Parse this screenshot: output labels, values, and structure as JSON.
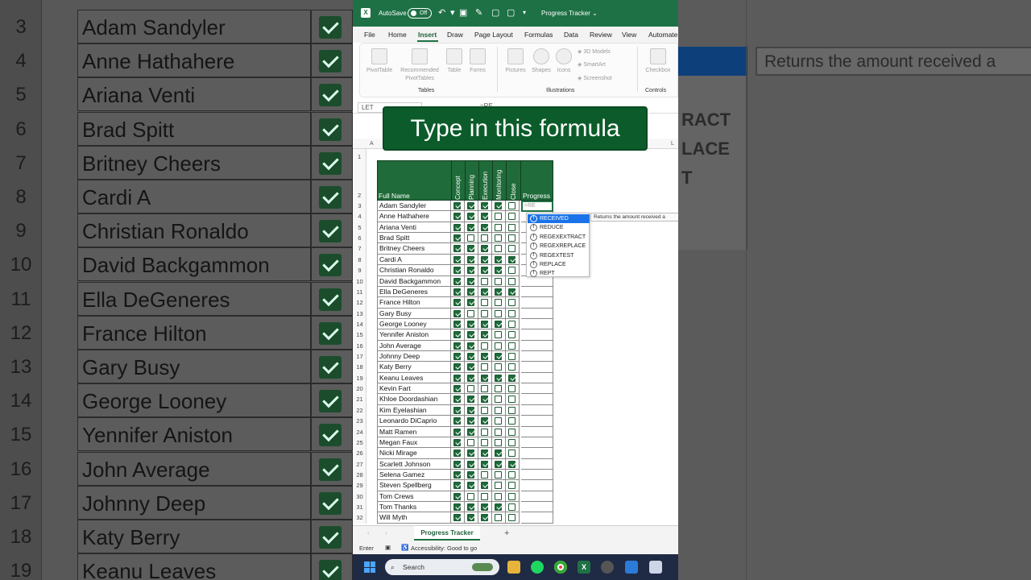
{
  "background": {
    "rows": [
      {
        "num": "3",
        "name": "Adam Sandyler"
      },
      {
        "num": "4",
        "name": "Anne Hathahere"
      },
      {
        "num": "5",
        "name": "Ariana Venti"
      },
      {
        "num": "6",
        "name": "Brad Spitt"
      },
      {
        "num": "7",
        "name": "Britney Cheers"
      },
      {
        "num": "8",
        "name": "Cardi A"
      },
      {
        "num": "9",
        "name": "Christian Ronaldo"
      },
      {
        "num": "10",
        "name": "David Backgammon"
      },
      {
        "num": "11",
        "name": "Ella DeGeneres"
      },
      {
        "num": "12",
        "name": "France Hilton"
      },
      {
        "num": "13",
        "name": "Gary Busy"
      },
      {
        "num": "14",
        "name": "George Looney"
      },
      {
        "num": "15",
        "name": "Yennifer Aniston"
      },
      {
        "num": "16",
        "name": "John Average"
      },
      {
        "num": "17",
        "name": "Johnny Deep"
      },
      {
        "num": "18",
        "name": "Katy Berry"
      },
      {
        "num": "19",
        "name": "Keanu Leaves"
      }
    ],
    "tooltip": "Returns the amount received a",
    "fragments": [
      "RACT",
      "LACE",
      "T"
    ]
  },
  "titlebar": {
    "app_icon": "X",
    "autosave": "AutoSave",
    "toggle": "Off",
    "doc_title": "Progress Tracker ⌄"
  },
  "menu": [
    "File",
    "Home",
    "Insert",
    "Draw",
    "Page Layout",
    "Formulas",
    "Data",
    "Review",
    "View",
    "Automate"
  ],
  "ribbon": {
    "buttons": [
      "PivotTable",
      "Recommended PivotTables",
      "Table",
      "Forms",
      "Pictures",
      "Shapes",
      "Icons",
      "3D Models",
      "SmartArt",
      "Screenshot",
      "Checkbox"
    ],
    "groups": [
      "Tables",
      "Illustrations",
      "Controls"
    ]
  },
  "formula_bar": {
    "name_box": "LET",
    "formula": "=RE"
  },
  "overlay_text": "Type in this formula",
  "columns": {
    "a": "A",
    "l": "L"
  },
  "table": {
    "header_name": "Full Name",
    "header_cols": [
      "Concept",
      "Planning",
      "Execution",
      "Monitoring",
      "Close"
    ],
    "header_progress": "Progress",
    "rows": [
      {
        "n": "3",
        "name": "Adam Sandyler",
        "c": [
          1,
          1,
          1,
          1,
          0
        ]
      },
      {
        "n": "4",
        "name": "Anne Hathahere",
        "c": [
          1,
          1,
          1,
          0,
          0
        ]
      },
      {
        "n": "5",
        "name": "Ariana Venti",
        "c": [
          1,
          1,
          1,
          0,
          0
        ]
      },
      {
        "n": "6",
        "name": "Brad Spitt",
        "c": [
          1,
          0,
          0,
          0,
          0
        ]
      },
      {
        "n": "7",
        "name": "Britney Cheers",
        "c": [
          1,
          1,
          1,
          0,
          0
        ]
      },
      {
        "n": "8",
        "name": "Cardi A",
        "c": [
          1,
          1,
          1,
          1,
          1
        ]
      },
      {
        "n": "9",
        "name": "Christian Ronaldo",
        "c": [
          1,
          1,
          1,
          1,
          0
        ]
      },
      {
        "n": "10",
        "name": "David Backgammon",
        "c": [
          1,
          1,
          0,
          0,
          0
        ]
      },
      {
        "n": "11",
        "name": "Ella DeGeneres",
        "c": [
          1,
          1,
          1,
          1,
          1
        ]
      },
      {
        "n": "12",
        "name": "France Hilton",
        "c": [
          1,
          1,
          0,
          0,
          0
        ]
      },
      {
        "n": "13",
        "name": "Gary Busy",
        "c": [
          1,
          0,
          0,
          0,
          0
        ]
      },
      {
        "n": "14",
        "name": "George Looney",
        "c": [
          1,
          1,
          1,
          1,
          0
        ]
      },
      {
        "n": "15",
        "name": "Yennifer Aniston",
        "c": [
          1,
          1,
          1,
          0,
          0
        ]
      },
      {
        "n": "16",
        "name": "John Average",
        "c": [
          1,
          1,
          0,
          0,
          0
        ]
      },
      {
        "n": "17",
        "name": "Johnny Deep",
        "c": [
          1,
          1,
          1,
          1,
          0
        ]
      },
      {
        "n": "18",
        "name": "Katy Berry",
        "c": [
          1,
          1,
          0,
          0,
          0
        ]
      },
      {
        "n": "19",
        "name": "Keanu Leaves",
        "c": [
          1,
          1,
          1,
          1,
          1
        ]
      },
      {
        "n": "20",
        "name": "Kevin Fart",
        "c": [
          1,
          0,
          0,
          0,
          0
        ]
      },
      {
        "n": "21",
        "name": "Khloe Doordashian",
        "c": [
          1,
          1,
          1,
          0,
          0
        ]
      },
      {
        "n": "22",
        "name": "Kim Eyelashian",
        "c": [
          1,
          1,
          0,
          0,
          0
        ]
      },
      {
        "n": "23",
        "name": "Leonardo DiCaprio",
        "c": [
          1,
          1,
          1,
          0,
          0
        ]
      },
      {
        "n": "24",
        "name": "Matt Ramen",
        "c": [
          1,
          1,
          0,
          0,
          0
        ]
      },
      {
        "n": "25",
        "name": "Megan Faux",
        "c": [
          1,
          0,
          0,
          0,
          0
        ]
      },
      {
        "n": "26",
        "name": "Nicki Mirage",
        "c": [
          1,
          1,
          1,
          1,
          0
        ]
      },
      {
        "n": "27",
        "name": "Scarlett Johnson",
        "c": [
          1,
          1,
          1,
          1,
          1
        ]
      },
      {
        "n": "28",
        "name": "Selena Gamez",
        "c": [
          1,
          1,
          0,
          0,
          0
        ]
      },
      {
        "n": "29",
        "name": "Steven Spellberg",
        "c": [
          1,
          1,
          1,
          0,
          0
        ]
      },
      {
        "n": "30",
        "name": "Tom Crews",
        "c": [
          1,
          0,
          0,
          0,
          0
        ]
      },
      {
        "n": "31",
        "name": "Tom Thanks",
        "c": [
          1,
          1,
          1,
          1,
          0
        ]
      },
      {
        "n": "32",
        "name": "Will Myth",
        "c": [
          1,
          1,
          1,
          0,
          0
        ]
      }
    ]
  },
  "active_cell_text": "=RE",
  "autocomplete": {
    "items": [
      "RECEIVED",
      "REDUCE",
      "REGEXEXTRACT",
      "REGEXREPLACE",
      "REGEXTEST",
      "REPLACE",
      "REPT"
    ],
    "tooltip": "Returns the amount received a"
  },
  "sheet_tab": "Progress Tracker",
  "status": {
    "mode": "Enter",
    "accessibility": "Accessibility: Good to go"
  },
  "taskbar": {
    "search": "Search"
  },
  "colors": {
    "excel_green": "#1e7145",
    "header_green": "#1f6b39",
    "select_blue": "#1a73e8"
  }
}
